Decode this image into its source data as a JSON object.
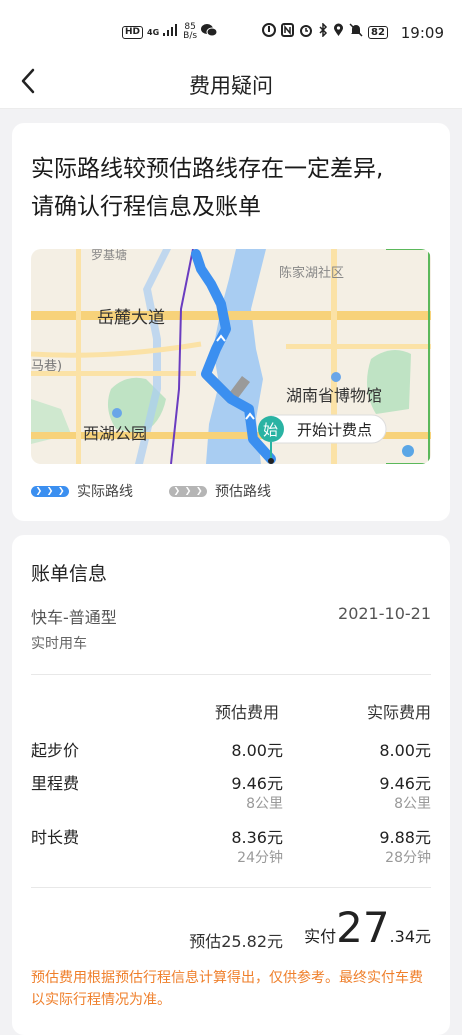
{
  "status_bar": {
    "hd": "HD",
    "network": "4G",
    "speed_value": "85",
    "speed_unit": "B/s",
    "battery": "82",
    "time": "19:09"
  },
  "header": {
    "back_icon": "chevron-left-icon",
    "title": "费用疑问"
  },
  "route_card": {
    "headline_line1": "实际路线较预估路线存在一定差异,",
    "headline_line2": "请确认行程信息及账单",
    "map_labels": {
      "luojitang": "罗基塘",
      "chenjiahu": "陈家湖社区",
      "yuelu_road": "岳麓大道",
      "xiang": "马巷)",
      "museum": "湖南省博物馆",
      "xihu_park": "西湖公园",
      "start_badge": "始",
      "start_text": "开始计费点"
    },
    "legend": {
      "actual": "实际路线",
      "estimated": "预估路线"
    },
    "colors": {
      "actual_route": "#3b8ff0",
      "estimated_route": "#9a9a9a",
      "start_marker": "#2ab3a3"
    }
  },
  "bill": {
    "section_title": "账单信息",
    "car_type": "快车-普通型",
    "trip_date": "2021-10-21",
    "trip_mode": "实时用车",
    "col_estimated": "预估费用",
    "col_actual": "实际费用",
    "rows": [
      {
        "label": "起步价",
        "estimated": "8.00元",
        "actual": "8.00元",
        "estimated_sub": "",
        "actual_sub": ""
      },
      {
        "label": "里程费",
        "estimated": "9.46元",
        "actual": "9.46元",
        "estimated_sub": "8公里",
        "actual_sub": "8公里"
      },
      {
        "label": "时长费",
        "estimated": "8.36元",
        "actual": "9.88元",
        "estimated_sub": "24分钟",
        "actual_sub": "28分钟"
      }
    ],
    "estimated_total": "预估25.82元",
    "paid_label": "实付",
    "paid_integer": "27",
    "paid_decimal": ".34元",
    "note": "预估费用根据预估行程信息计算得出，仅供参考。最终实付车费以实际行程情况为准。",
    "note_color": "#ef7f2b"
  }
}
